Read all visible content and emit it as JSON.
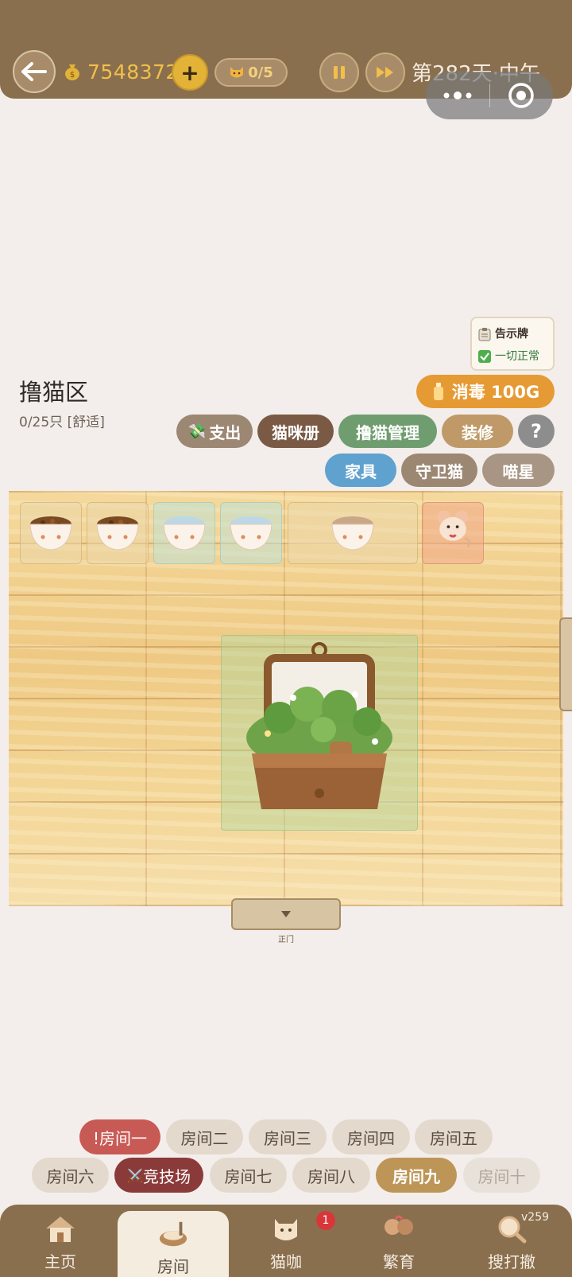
{
  "topbar": {
    "coins": "7548372",
    "cat_count": "0/5",
    "day_text": "第282天·中午",
    "icons": [
      "back-arrow-icon",
      "money-bag-icon",
      "plus-icon",
      "cat-face-icon",
      "pause-icon",
      "fast-forward-icon",
      "more-dots-icon",
      "target-icon"
    ]
  },
  "notice": {
    "title": "告示牌",
    "status": "一切正常"
  },
  "area": {
    "title": "撸猫区",
    "subtitle": "0/25只 [舒适]",
    "disinfect_label": "消毒 100G"
  },
  "actions": {
    "expense": "支出",
    "cat_book": "猫咪册",
    "pet_manage": "撸猫管理",
    "decorate": "装修",
    "help": "?",
    "furniture": "家具",
    "guard_cat": "守卫猫",
    "meow_star": "喵星"
  },
  "floor": {
    "door_label": "正门"
  },
  "rooms": {
    "row1": [
      "!房间一",
      "房间二",
      "房间三",
      "房间四",
      "房间五"
    ],
    "row2": [
      "房间六",
      "竞技场",
      "房间七",
      "房间八",
      "房间九",
      "房间十"
    ],
    "arena_icon": "⚔️",
    "active_room": "房间九"
  },
  "nav": {
    "items": [
      "主页",
      "房间",
      "猫咖",
      "繁育",
      "搜打撤"
    ],
    "active": "房间",
    "badge": "1",
    "version": "v259"
  },
  "colors": {
    "brand_brown": "#8a6f4f",
    "coin_gold": "#f2c04a",
    "disinfect_orange": "#e69a33",
    "alert_red": "#c85a55",
    "active_room": "#bd9657"
  }
}
